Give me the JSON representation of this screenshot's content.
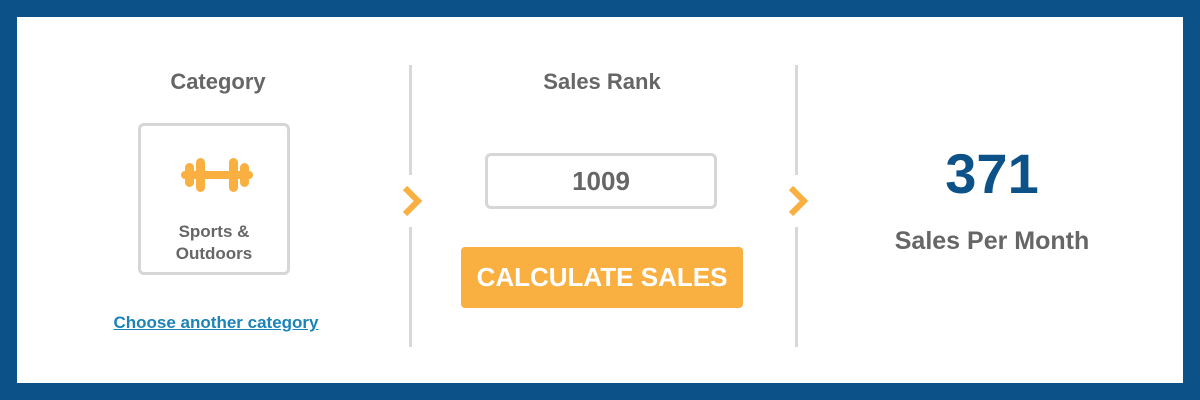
{
  "category": {
    "title": "Category",
    "selected_label_line1": "Sports &",
    "selected_label_line2": "Outdoors",
    "selected_icon": "dumbbell-icon",
    "change_link": "Choose another category"
  },
  "sales_rank": {
    "title": "Sales Rank",
    "value": "1009",
    "button_label": "CALCULATE SALES"
  },
  "result": {
    "value": "371",
    "label": "Sales Per Month"
  },
  "colors": {
    "frame": "#0c5289",
    "accent": "#f9b040",
    "result": "#0c5289",
    "link": "#1b83b7",
    "text": "#666666"
  }
}
